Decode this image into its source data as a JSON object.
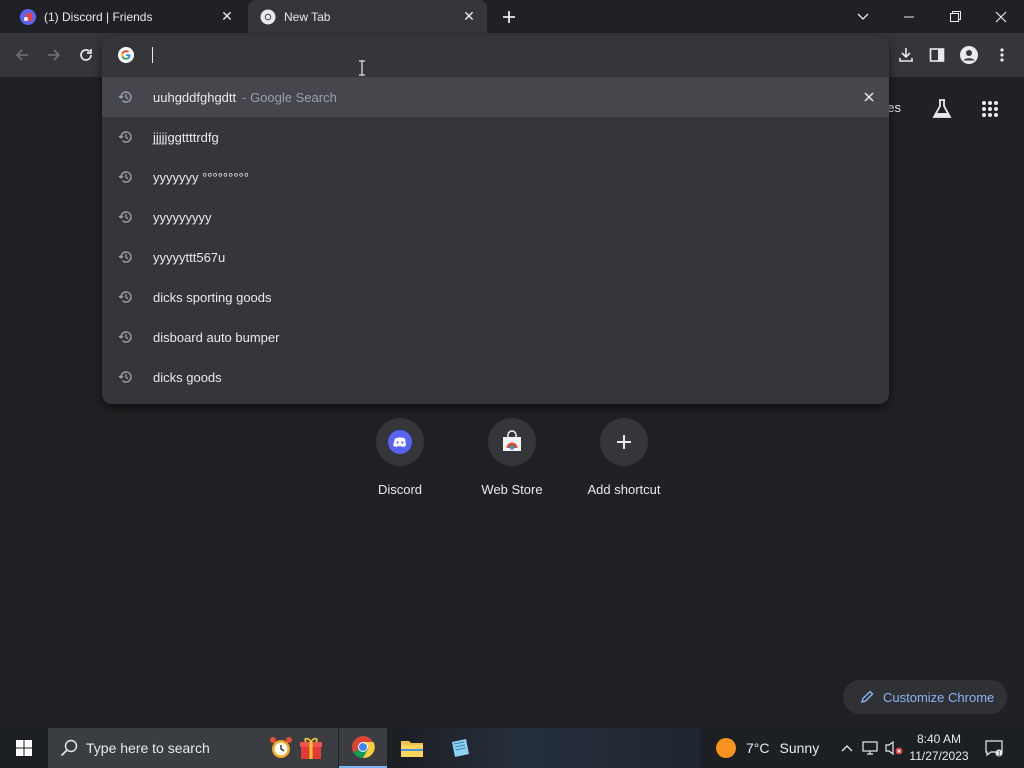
{
  "tabs": [
    {
      "title": "(1) Discord | Friends",
      "icon": "discord-favicon",
      "active": false
    },
    {
      "title": "New Tab",
      "icon": "chrome-favicon",
      "active": true
    }
  ],
  "omnibox": {
    "value": "",
    "suggestions": [
      {
        "text": "uuhgddfghgdtt",
        "suffix": "- Google Search",
        "icon": "history-icon",
        "selected": true
      },
      {
        "text": "jjjjjggttttrdfg",
        "icon": "history-icon"
      },
      {
        "text": "yyyyyyy °°°°°°°°°",
        "icon": "history-icon"
      },
      {
        "text": "yyyyyyyyy",
        "icon": "history-icon"
      },
      {
        "text": "yyyyyttt567u",
        "icon": "history-icon"
      },
      {
        "text": "dicks sporting goods",
        "icon": "history-icon"
      },
      {
        "text": "disboard auto bumper",
        "icon": "history-icon"
      },
      {
        "text": "dicks goods",
        "icon": "history-icon"
      }
    ]
  },
  "page": {
    "images_link_partial": "ges",
    "shortcuts": [
      {
        "label": "Discord",
        "icon": "discord-icon"
      },
      {
        "label": "Web Store",
        "icon": "web-store-icon"
      },
      {
        "label": "Add shortcut",
        "icon": "plus-icon"
      }
    ],
    "customize_label": "Customize Chrome"
  },
  "taskbar": {
    "search_placeholder": "Type here to search",
    "weather": {
      "temp": "7°C",
      "condition": "Sunny"
    },
    "clock": {
      "time": "8:40 AM",
      "date": "11/27/2023"
    }
  },
  "colors": {
    "page_bg": "#202124",
    "toolbar_bg": "#35363a",
    "accent_blue": "#8ab4f8",
    "discord_purple": "#5865f2"
  }
}
